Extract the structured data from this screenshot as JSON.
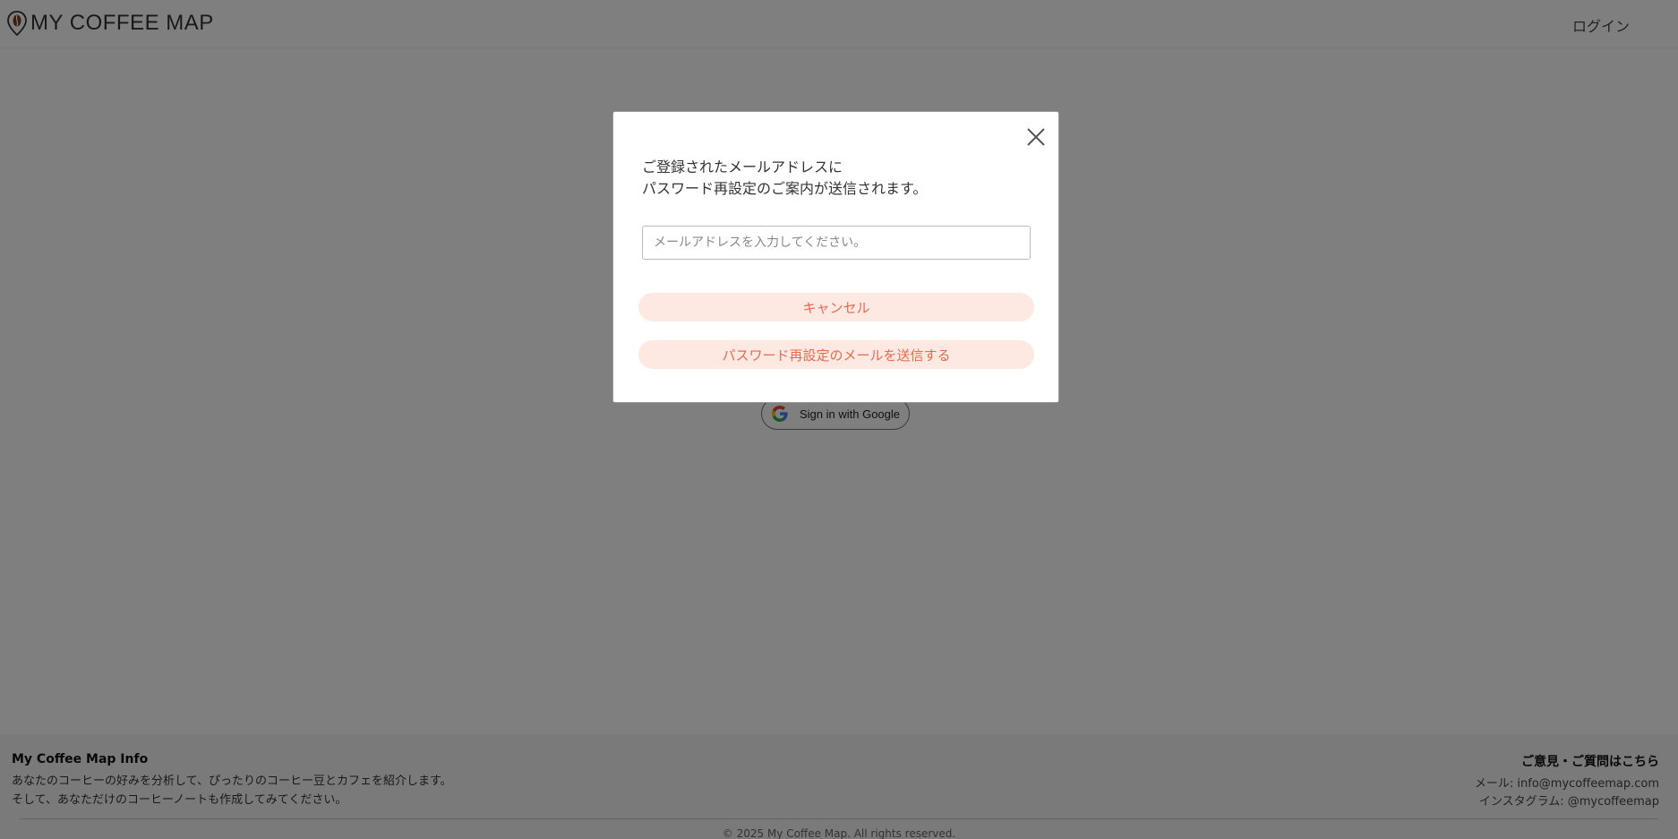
{
  "header": {
    "logo_text": "MY COFFEE MAP",
    "login_label": "ログイン"
  },
  "google_signin": {
    "label": "Sign in with Google"
  },
  "footer": {
    "title": "My Coffee Map Info",
    "desc_line1": "あなたのコーヒーの好みを分析して、ぴったりのコーヒー豆とカフェを紹介します。",
    "desc_line2": "そして、あなただけのコーヒーノートも作成してみてください。",
    "contact_title": "ご意見・ご質問はこちら",
    "mail": "メール: info@mycoffeemap.com",
    "instagram": "インスタグラム: @mycoffeemap",
    "copyright": "© 2025 My Coffee Map. All rights reserved."
  },
  "modal": {
    "message_line1": "ご登録されたメールアドレスに",
    "message_line2": "パスワード再設定のご案内が送信されます。",
    "email_placeholder": "メールアドレスを入力してください。",
    "email_value": "",
    "cancel_label": "キャンセル",
    "send_label": "パスワード再設定のメールを送信する"
  },
  "colors": {
    "button_bg": "#fde8e2",
    "button_text": "#e86a4f",
    "overlay": "rgba(0,0,0,0.5)"
  },
  "icons": {
    "logo": "coffee-bean-pin-icon",
    "close": "close-icon",
    "google": "google-g-icon"
  }
}
